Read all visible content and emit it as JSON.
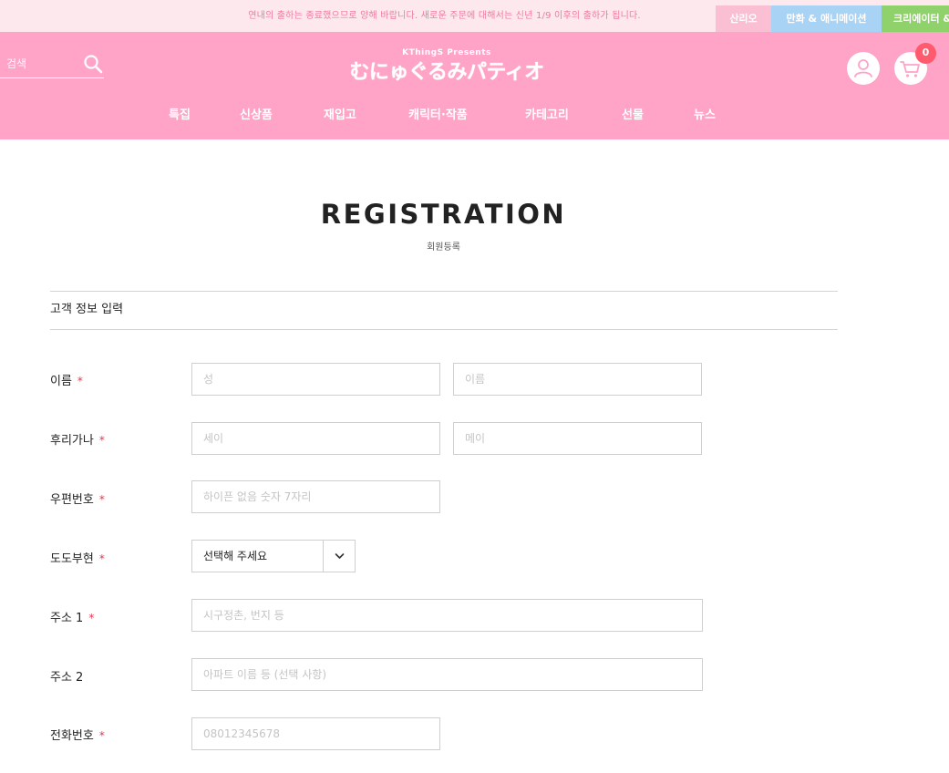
{
  "top_bar": {
    "notice": "연내의 출하는 종료했으므로 양해 바랍니다. 새로운 주문에 대해서는 신년 1/9 이후의 출하가 됩니다.",
    "brand_tabs": [
      "산리오",
      "만화 & 애니메이션",
      "크리에이터 &"
    ]
  },
  "header": {
    "search_placeholder": "검색",
    "logo_sub": "KThingS Presents",
    "logo_main": "むにゅぐるみパティオ",
    "cart_count": "0",
    "nav": [
      "특집",
      "신상품",
      "재입고",
      "캐릭터·작품",
      "카테고리",
      "선물",
      "뉴스"
    ]
  },
  "page": {
    "title": "REGISTRATION",
    "subtitle": "회원등록",
    "section_title": "고객 정보 입력"
  },
  "form": {
    "name": {
      "label": "이름",
      "last_placeholder": "성",
      "first_placeholder": "이름"
    },
    "furigana": {
      "label": "후리가나",
      "last_placeholder": "세이",
      "first_placeholder": "메이"
    },
    "postal": {
      "label": "우편번호",
      "placeholder": "하이픈 없음 숫자 7자리"
    },
    "prefecture": {
      "label": "도도부현",
      "value": "선택해 주세요"
    },
    "address1": {
      "label": "주소 1",
      "placeholder": "시구정촌, 번지 등"
    },
    "address2": {
      "label": "주소 2",
      "placeholder": "아파트 이름 등 (선택 사항)"
    },
    "phone": {
      "label": "전화번호",
      "placeholder": "08012345678"
    },
    "required_mark": "*"
  },
  "colors": {
    "header_bg": "#ffa4c6",
    "notice_bg": "#fde8ee",
    "required": "#e8364e",
    "cart_badge": "#ff5a6e"
  },
  "icons": [
    "search-icon",
    "user-icon",
    "cart-icon",
    "chevron-down-icon"
  ]
}
